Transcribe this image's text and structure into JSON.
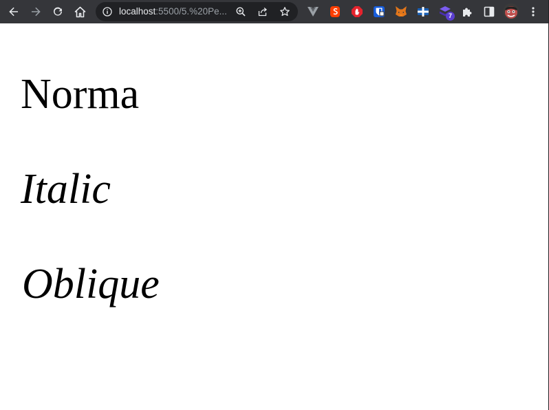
{
  "browser": {
    "url_host": "localhost",
    "url_rest": ":5500/5.%20Pe...",
    "extensions": [
      "vue-devtools-icon",
      "svelte-icon",
      "adblock-icon",
      "bitwarden-icon",
      "metamask-icon",
      "ublock-icon",
      "stack-icon",
      "puzzle-icon"
    ],
    "extension_badge": "7",
    "colors": {
      "toolbar": "#35363a",
      "omnibox": "#202124",
      "icon": "#e8eaed"
    }
  },
  "page": {
    "lines": [
      {
        "text": "Norma",
        "style": "normal"
      },
      {
        "text": "Italic",
        "style": "italic"
      },
      {
        "text": "Oblique",
        "style": "oblique"
      }
    ]
  }
}
